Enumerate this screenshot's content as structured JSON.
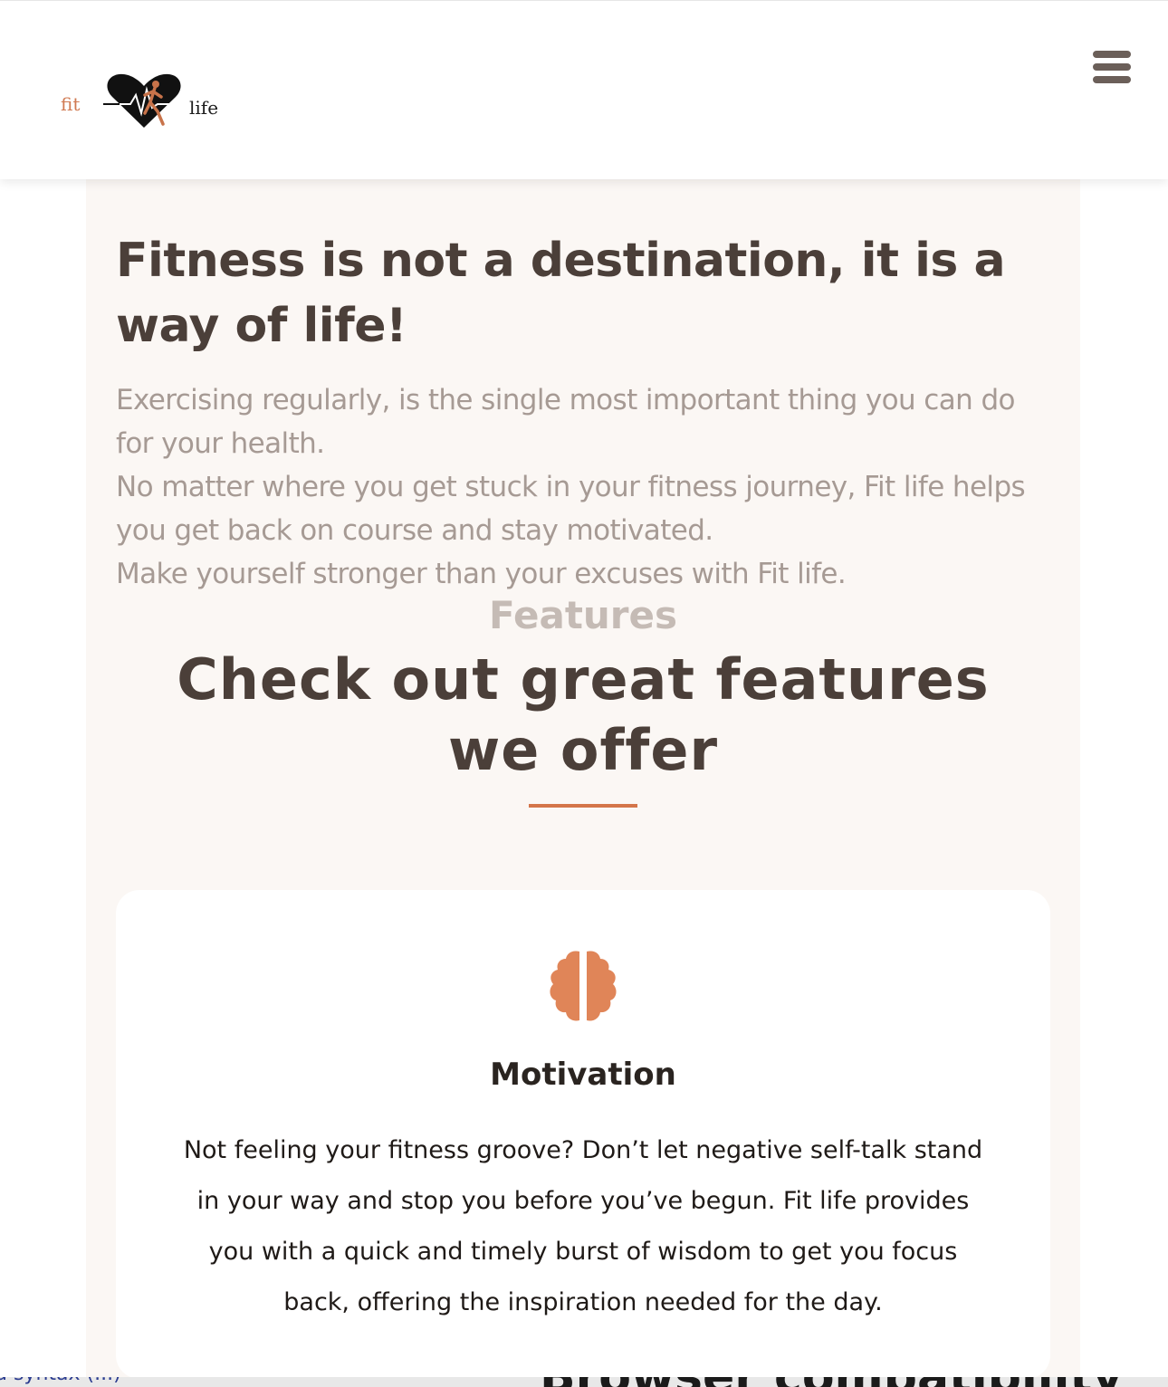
{
  "header": {
    "logo": {
      "left_text": "fit",
      "right_text": "life"
    },
    "menu_icon": "hamburger-menu-icon"
  },
  "hero": {
    "title": "Fitness is not a destination, it is a way of life!",
    "paragraphs": [
      "Exercising regularly, is the single most important thing you can do for your health.",
      "No matter where you get stuck in your fitness journey, Fit life helps you get back on course and stay motivated.",
      "Make yourself stronger than your excuses with Fit life."
    ]
  },
  "features": {
    "label": "Features",
    "title": "Check out great features we offer"
  },
  "card": {
    "icon": "brain-icon",
    "title": "Motivation",
    "text": "Not feeling your fitness groove? Don’t let negative self-talk stand in your way and stop you before you’ve begun. Fit life provides you with a quick and timely burst of wisdom to get you focus back, offering the inspiration needed for the day."
  },
  "bottom_overlay": {
    "left_text": "d syntax (...)",
    "right_text": "Browser compatibility"
  },
  "colors": {
    "accent": "#d4754a",
    "heading": "#4b3f39",
    "muted_text": "#a69a94",
    "section_bg": "#fbf7f4",
    "icon": "#e08558",
    "menu_icon": "#6b5f59"
  }
}
